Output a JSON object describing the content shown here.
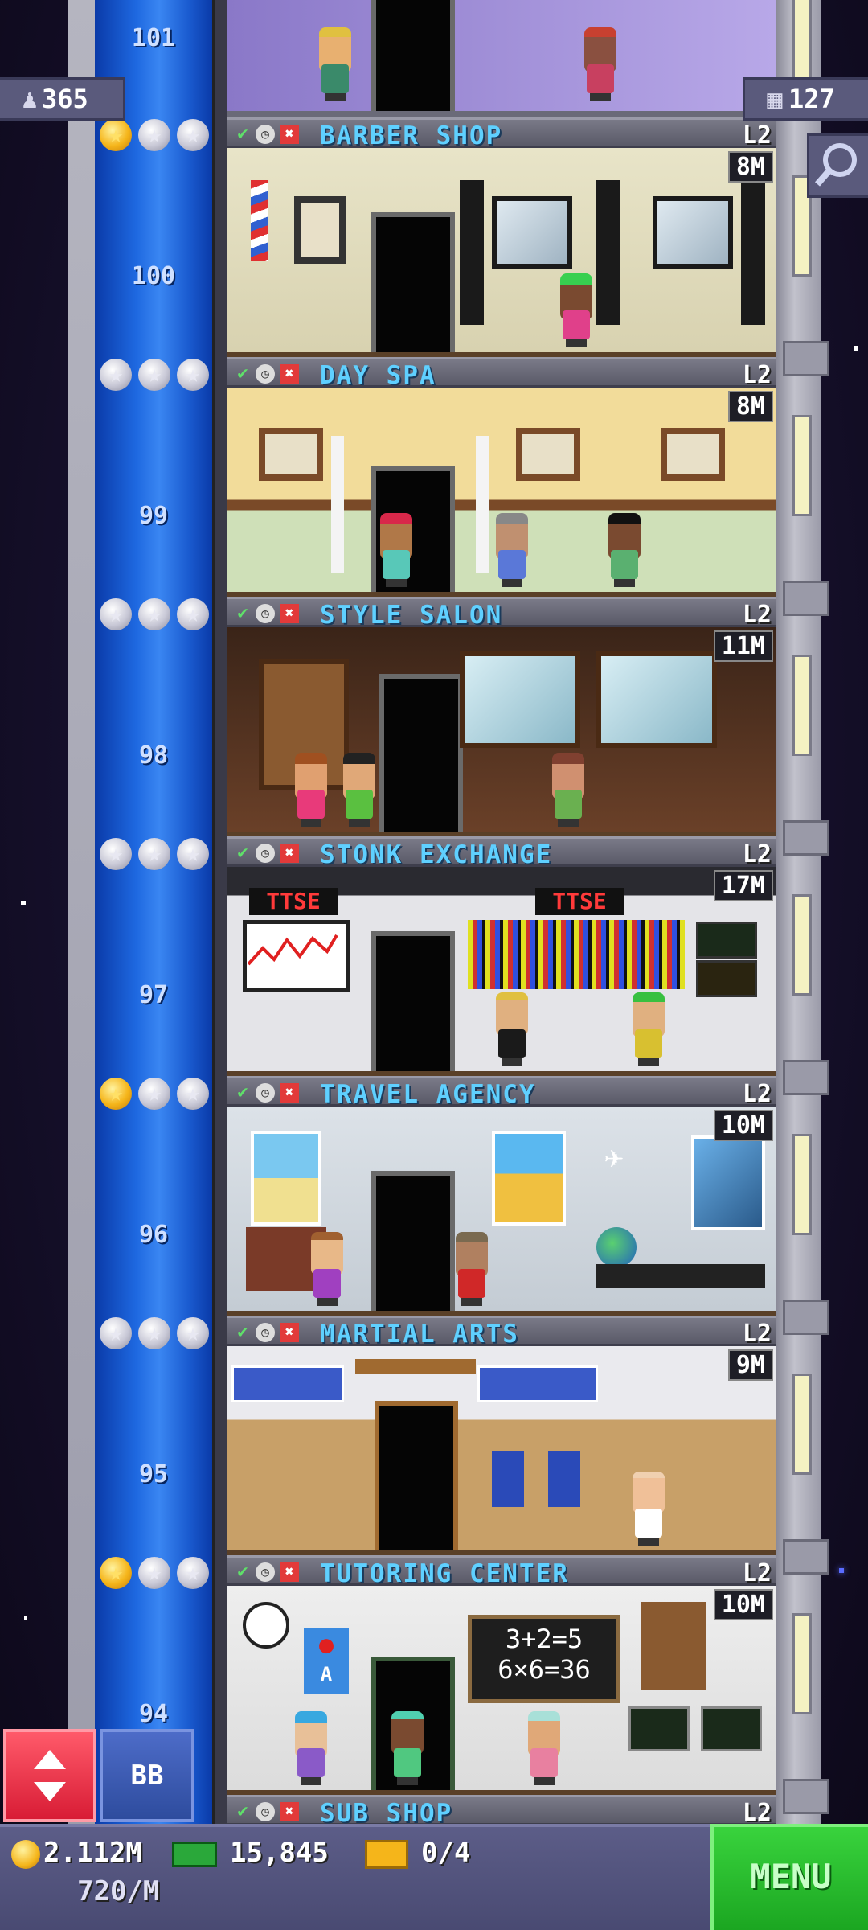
{
  "hud": {
    "population": "365",
    "floors_count": "127"
  },
  "top_floor_number": "101",
  "floors": [
    {
      "name": "BARBER SHOP",
      "level": "L2",
      "price": "8M",
      "floor_no": "100",
      "gold_stars": 1
    },
    {
      "name": "DAY SPA",
      "level": "L2",
      "price": "8M",
      "floor_no": "99",
      "gold_stars": 0
    },
    {
      "name": "STYLE SALON",
      "level": "L2",
      "price": "11M",
      "floor_no": "98",
      "gold_stars": 0
    },
    {
      "name": "STONK EXCHANGE",
      "level": "L2",
      "price": "17M",
      "floor_no": "97",
      "gold_stars": 0,
      "signs": [
        "TTSE",
        "TTSE"
      ]
    },
    {
      "name": "TRAVEL AGENCY",
      "level": "L2",
      "price": "10M",
      "floor_no": "96",
      "gold_stars": 1
    },
    {
      "name": "MARTIAL ARTS",
      "level": "L2",
      "price": "9M",
      "floor_no": "95",
      "gold_stars": 0
    },
    {
      "name": "TUTORING CENTER",
      "level": "L2",
      "price": "10M",
      "floor_no": "94",
      "gold_stars": 1,
      "board": [
        "3+2=5",
        "6×6=36"
      ],
      "apple_letter": "A"
    },
    {
      "name": "SUB SHOP",
      "level": "L2"
    }
  ],
  "bottom": {
    "coins": "2.112M",
    "coin_rate": "720/M",
    "bux": "15,845",
    "tickets": "0/4",
    "menu_label": "MENU",
    "bb_label": "BB"
  },
  "colors": {
    "elevator_blue": "#1e68e0",
    "menu_green": "#1ba621",
    "floor_name_cyan": "#5fd0ff",
    "elevator_button_red": "#d81c35"
  }
}
